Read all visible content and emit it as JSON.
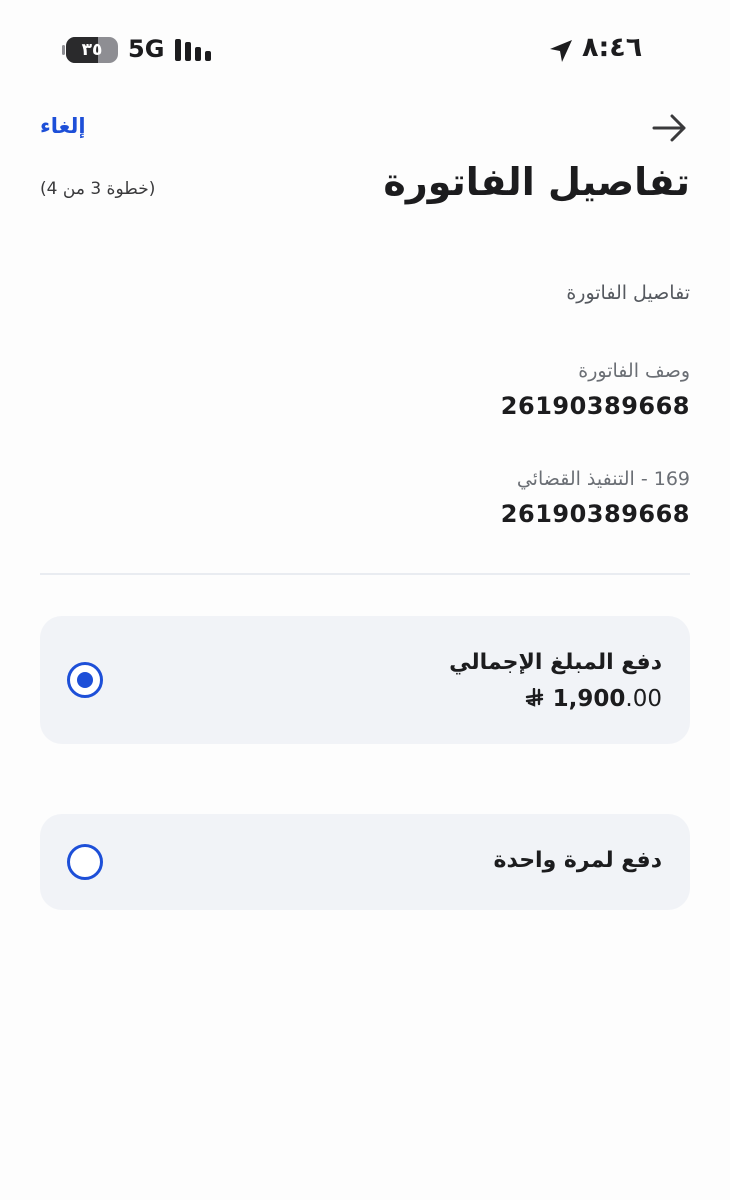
{
  "status_bar": {
    "time": "٨:٤٦",
    "network": "5G",
    "battery": "٣٥"
  },
  "header": {
    "cancel_label": "إلغاء",
    "title": "تفاصيل الفاتورة",
    "step": "(خطوة 3 من 4)"
  },
  "details": {
    "section_label": "تفاصيل الفاتورة",
    "fields": [
      {
        "label": "وصف الفاتورة",
        "value": "26190389668"
      },
      {
        "label": "169 - التنفيذ القضائي",
        "value": "26190389668"
      }
    ]
  },
  "payment_options": [
    {
      "title": "دفع المبلغ الإجمالي",
      "amount_int": "1,900",
      "amount_dec": ".00",
      "currency": "riyal-sign-icon",
      "selected": true
    },
    {
      "title": "دفع لمرة واحدة",
      "selected": false
    }
  ],
  "colors": {
    "accent": "#1d4fd8",
    "card_bg": "#f1f3f7"
  }
}
